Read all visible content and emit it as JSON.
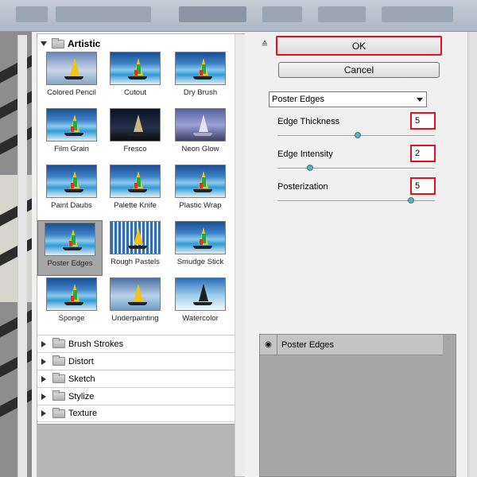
{
  "gallery": {
    "open_category": "Artistic",
    "thumbnails": [
      {
        "label": "Colored Pencil"
      },
      {
        "label": "Cutout"
      },
      {
        "label": "Dry Brush"
      },
      {
        "label": "Film Grain"
      },
      {
        "label": "Fresco"
      },
      {
        "label": "Neon Glow"
      },
      {
        "label": "Paint Daubs"
      },
      {
        "label": "Palette Knife"
      },
      {
        "label": "Plastic Wrap"
      },
      {
        "label": "Poster Edges"
      },
      {
        "label": "Rough Pastels"
      },
      {
        "label": "Smudge Stick"
      },
      {
        "label": "Sponge"
      },
      {
        "label": "Underpainting"
      },
      {
        "label": "Watercolor"
      }
    ],
    "selected": "Poster Edges",
    "collapsed_categories": [
      "Brush Strokes",
      "Distort",
      "Sketch",
      "Stylize",
      "Texture"
    ]
  },
  "buttons": {
    "ok": "OK",
    "cancel": "Cancel"
  },
  "filter_select": {
    "value": "Poster Edges"
  },
  "params": {
    "edge_thickness": {
      "label": "Edge Thickness",
      "value": "5"
    },
    "edge_intensity": {
      "label": "Edge Intensity",
      "value": "2"
    },
    "posterization": {
      "label": "Posterization",
      "value": "5"
    }
  },
  "layers": {
    "items": [
      {
        "name": "Poster Edges"
      }
    ]
  },
  "colors": {
    "highlight": "#e0121f",
    "slider_thumb": "#5bb3b7"
  }
}
